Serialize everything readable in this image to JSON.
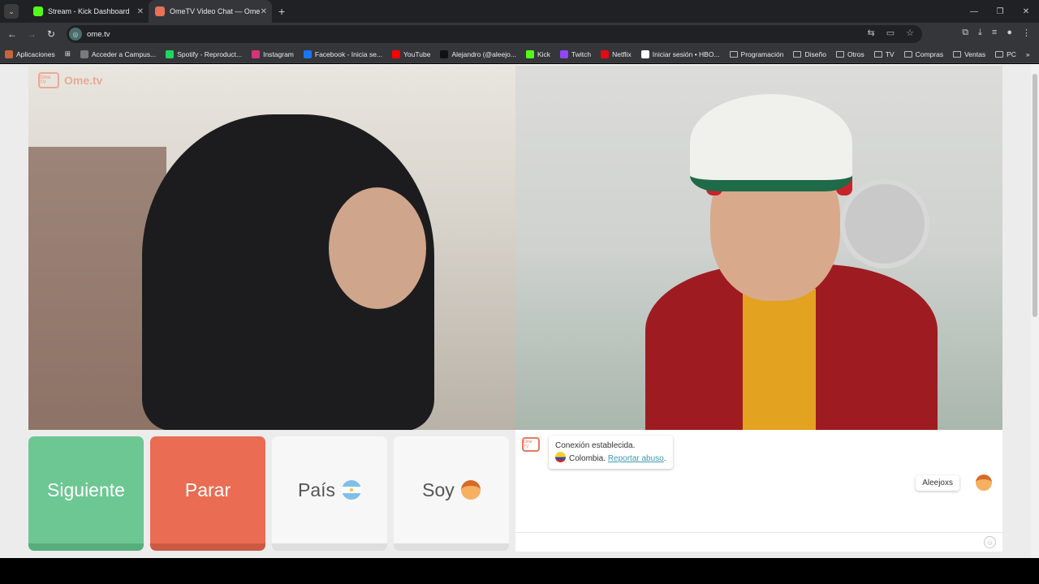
{
  "browser": {
    "tabs": [
      {
        "title": "Stream - Kick Dashboard",
        "favicon_color": "#53fc18"
      },
      {
        "title": "OmeTV Video Chat — Ome",
        "favicon_color": "#e8715a"
      }
    ],
    "url": "ome.tv",
    "bookmarks": [
      {
        "label": "Aplicaciones",
        "type": "apps"
      },
      {
        "label": "Acceder a Campus...",
        "type": "link",
        "color": "#7a7a7a"
      },
      {
        "label": "Spotify - Reproduct...",
        "type": "link",
        "color": "#1ed760"
      },
      {
        "label": "Instagram",
        "type": "link",
        "color": "#d8337a"
      },
      {
        "label": "Facebook - Inicia se...",
        "type": "link",
        "color": "#1877f2"
      },
      {
        "label": "YouTube",
        "type": "link",
        "color": "#ff0000"
      },
      {
        "label": "Alejandro (@aleejo...",
        "type": "link",
        "color": "#111111"
      },
      {
        "label": "Kick",
        "type": "link",
        "color": "#53fc18"
      },
      {
        "label": "Twitch",
        "type": "link",
        "color": "#9146ff"
      },
      {
        "label": "Netflix",
        "type": "link",
        "color": "#e50914"
      },
      {
        "label": "Iniciar sesión • HBO...",
        "type": "link",
        "color": "#ffffff"
      },
      {
        "label": "Programación",
        "type": "folder"
      },
      {
        "label": "Diseño",
        "type": "folder"
      },
      {
        "label": "Otros",
        "type": "folder"
      },
      {
        "label": "TV",
        "type": "folder"
      },
      {
        "label": "Compras",
        "type": "folder"
      },
      {
        "label": "Ventas",
        "type": "folder"
      },
      {
        "label": "PC",
        "type": "folder"
      }
    ]
  },
  "omegle": {
    "logo_text": "Ome.tv",
    "logo_badge": "Ome TV",
    "buttons": {
      "next": "Siguiente",
      "stop": "Parar",
      "country": "País",
      "me": "Soy"
    },
    "chat": {
      "system_line1": "Conexión establecida.",
      "system_country": "Colombia.",
      "report_link": "Reportar abuso",
      "user_name": "Aleejoxs",
      "input_value": ""
    }
  },
  "colors": {
    "next": "#6dc793",
    "stop": "#e96c53",
    "link": "#3d9ab1"
  }
}
